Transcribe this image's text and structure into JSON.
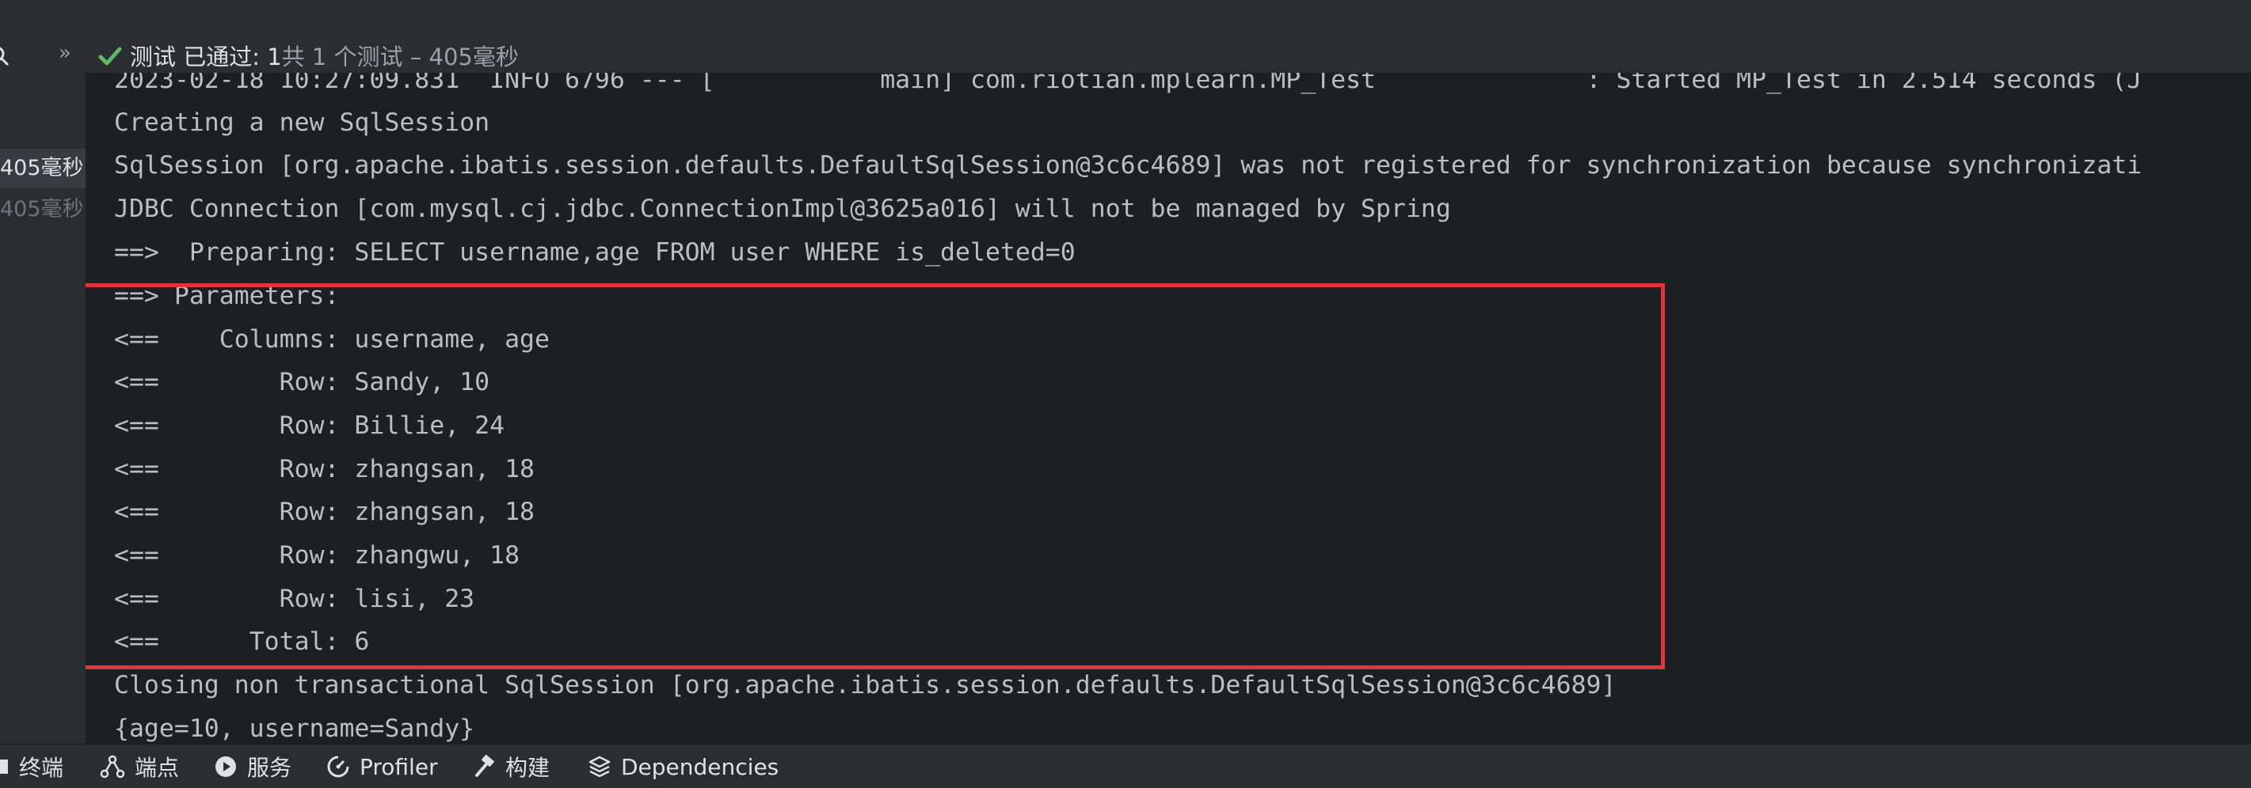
{
  "status_bar": {
    "chevrons": "»",
    "passed_label": "测试 已通过: 1",
    "summary": "共 1 个测试 – 405毫秒"
  },
  "test_tree": {
    "items": [
      {
        "label": "405毫秒",
        "selected": true
      },
      {
        "label": "405毫秒",
        "selected": false
      }
    ]
  },
  "console": {
    "lines": [
      "2023-02-18 10:27:09.831  INFO 6796 --- [           main] com.riotian.mplearn.MP_Test              : Started MP_Test in 2.514 seconds (J",
      "Creating a new SqlSession",
      "SqlSession [org.apache.ibatis.session.defaults.DefaultSqlSession@3c6c4689] was not registered for synchronization because synchronizati",
      "JDBC Connection [com.mysql.cj.jdbc.ConnectionImpl@3625a016] will not be managed by Spring",
      "==>  Preparing: SELECT username,age FROM user WHERE is_deleted=0",
      "==> Parameters: ",
      "<==    Columns: username, age",
      "<==        Row: Sandy, 10",
      "<==        Row: Billie, 24",
      "<==        Row: zhangsan, 18",
      "<==        Row: zhangsan, 18",
      "<==        Row: zhangwu, 18",
      "<==        Row: lisi, 23",
      "<==      Total: 6",
      "Closing non transactional SqlSession [org.apache.ibatis.session.defaults.DefaultSqlSession@3c6c4689]",
      "{age=10, username=Sandy}"
    ]
  },
  "bottom_bar": {
    "tools": [
      {
        "label": "终端",
        "icon": "terminal-icon"
      },
      {
        "label": "端点",
        "icon": "endpoints-icon"
      },
      {
        "label": "服务",
        "icon": "services-icon"
      },
      {
        "label": "Profiler",
        "icon": "profiler-icon"
      },
      {
        "label": "构建",
        "icon": "build-hammer-icon"
      },
      {
        "label": "Dependencies",
        "icon": "dependencies-layers-icon"
      }
    ]
  },
  "colors": {
    "pass_green": "#5fb865",
    "highlight_red": "#e0343a",
    "console_text": "#bcbec4"
  }
}
